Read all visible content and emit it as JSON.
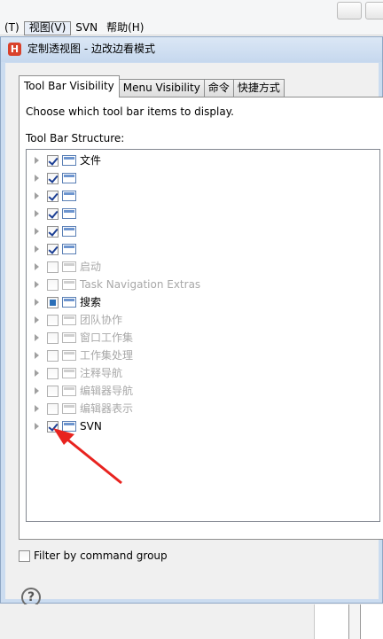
{
  "menubar": {
    "items": [
      {
        "label": "(T)"
      },
      {
        "label": "视图(V)",
        "active": true
      },
      {
        "label": "SVN"
      },
      {
        "label": "帮助(H)"
      }
    ]
  },
  "dialog": {
    "title": "定制透视图 - 边改边看模式",
    "logo_letter": "H",
    "tabs": [
      {
        "label": "Tool Bar Visibility",
        "active": true
      },
      {
        "label": "Menu Visibility"
      },
      {
        "label": "命令"
      },
      {
        "label": "快捷方式"
      }
    ],
    "description": "Choose which tool bar items to display.",
    "structure_label": "Tool Bar Structure:",
    "tree_items": [
      {
        "label": "文件",
        "state": "checked",
        "dim": false
      },
      {
        "label": "",
        "state": "checked",
        "dim": false
      },
      {
        "label": "",
        "state": "checked",
        "dim": false
      },
      {
        "label": "",
        "state": "checked",
        "dim": false
      },
      {
        "label": "",
        "state": "checked",
        "dim": false
      },
      {
        "label": "",
        "state": "checked",
        "dim": false
      },
      {
        "label": "启动",
        "state": "unchecked",
        "dim": true
      },
      {
        "label": "Task Navigation Extras",
        "state": "unchecked",
        "dim": true
      },
      {
        "label": "搜索",
        "state": "partial",
        "dim": false
      },
      {
        "label": "团队协作",
        "state": "unchecked",
        "dim": true
      },
      {
        "label": "窗口工作集",
        "state": "unchecked",
        "dim": true
      },
      {
        "label": "工作集处理",
        "state": "unchecked",
        "dim": true
      },
      {
        "label": "注释导航",
        "state": "unchecked",
        "dim": true
      },
      {
        "label": "编辑器导航",
        "state": "unchecked",
        "dim": true
      },
      {
        "label": "编辑器表示",
        "state": "unchecked",
        "dim": true
      },
      {
        "label": "SVN",
        "state": "checked",
        "dim": false
      }
    ],
    "filter_label": "Filter by command group",
    "help_symbol": "?"
  },
  "colors": {
    "annotation_arrow": "#e8231f",
    "title_bar": "#c6d8ee"
  }
}
